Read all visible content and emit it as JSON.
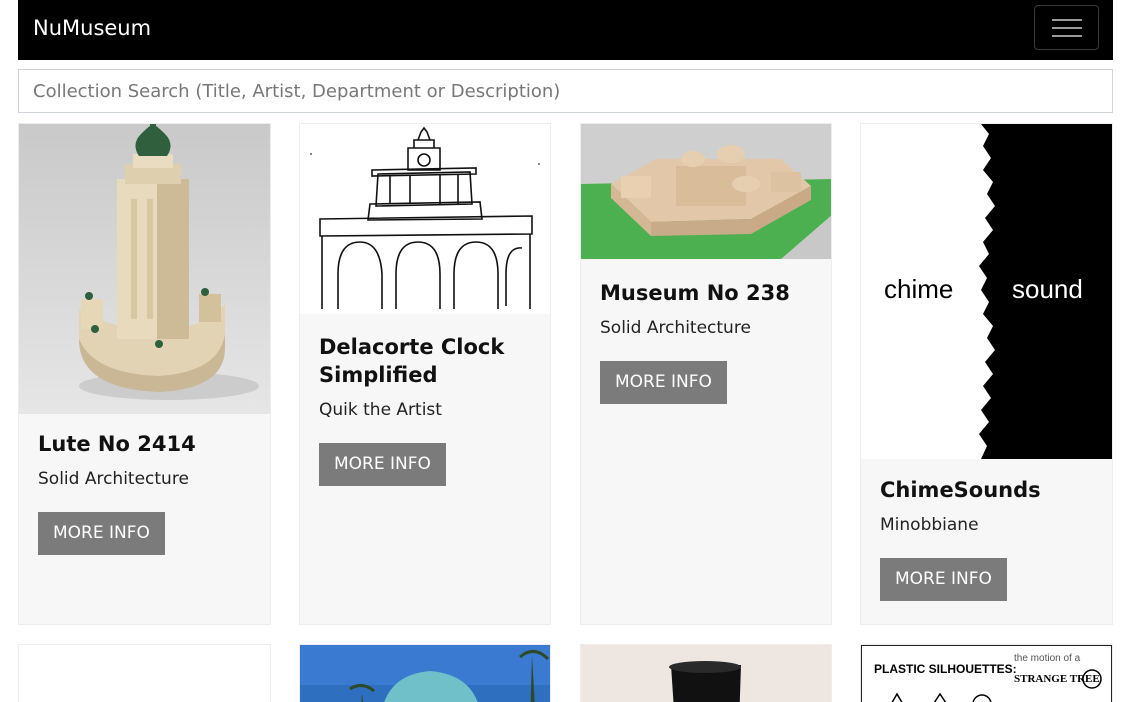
{
  "navbar": {
    "brand": "NuMuseum",
    "toggle_icon": "hamburger-icon"
  },
  "search": {
    "placeholder": "Collection Search (Title, Artist, Department or Description)",
    "value": ""
  },
  "cards": [
    {
      "title": "Lute No 2414",
      "artist": "Solid Architecture",
      "button": "MORE INFO"
    },
    {
      "title": "Delacorte Clock Simplified",
      "artist": "Quik the Artist",
      "button": "MORE INFO"
    },
    {
      "title": "Museum No 238",
      "artist": "Solid Architecture",
      "button": "MORE INFO"
    },
    {
      "title": "ChimeSounds",
      "artist": "Minobbiane",
      "button": "MORE INFO",
      "image_text": {
        "left": "chime",
        "right": "sound"
      }
    }
  ],
  "partial_cards": [
    {
      "image": "blank"
    },
    {
      "image": "blue-dome-building-photo"
    },
    {
      "image": "dark-object-photo"
    },
    {
      "image_text": {
        "title": "PLASTIC SILHOUETTES:",
        "subtitle": "the motion of a",
        "brand": "STRANGE TREE"
      }
    }
  ]
}
